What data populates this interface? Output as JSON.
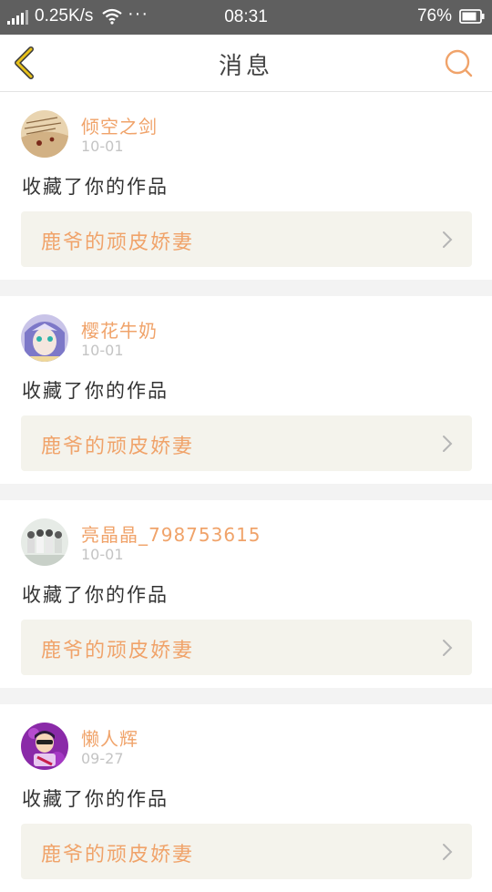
{
  "status_bar": {
    "network_speed": "0.25K/s",
    "more": "···",
    "time": "08:31",
    "battery": "76%"
  },
  "header": {
    "title": "消息",
    "back_icon": "chevron-left-icon",
    "search_icon": "search-icon"
  },
  "colors": {
    "accent": "#f0a36a",
    "back_arrow": "#e8c11a",
    "card_link_bg": "#f4f3ec",
    "separator": "#f3f3f3"
  },
  "messages": [
    {
      "user": "倾空之剑",
      "date": "10-01",
      "action": "收藏了你的作品",
      "work_title": "鹿爷的顽皮娇妻",
      "avatar": "book-page-avatar"
    },
    {
      "user": "樱花牛奶",
      "date": "10-01",
      "action": "收藏了你的作品",
      "work_title": "鹿爷的顽皮娇妻",
      "avatar": "anime-character-avatar"
    },
    {
      "user": "亮晶晶_798753615",
      "date": "10-01",
      "action": "收藏了你的作品",
      "work_title": "鹿爷的顽皮娇妻",
      "avatar": "group-photo-avatar"
    },
    {
      "user": "懒人辉",
      "date": "09-27",
      "action": "收藏了你的作品",
      "work_title": "鹿爷的顽皮娇妻",
      "avatar": "cartoon-guitarist-avatar"
    }
  ]
}
